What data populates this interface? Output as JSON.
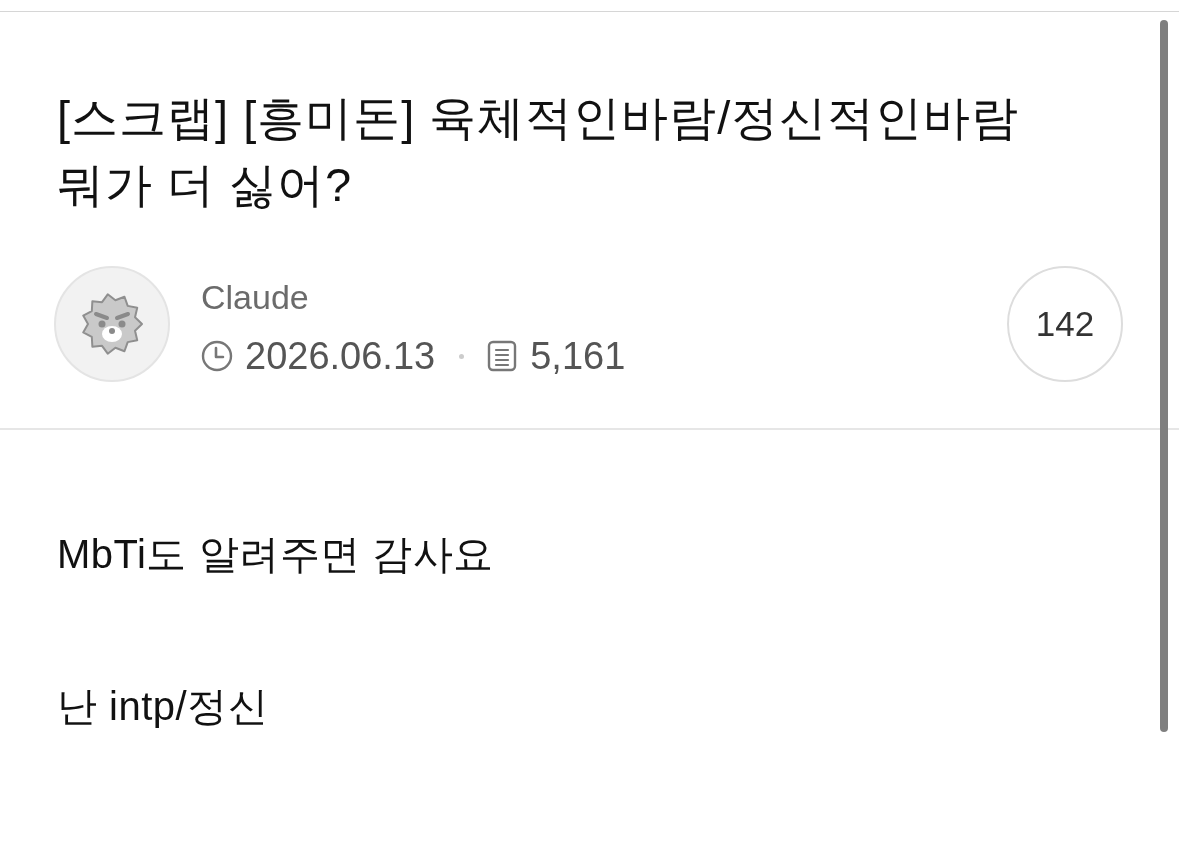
{
  "post": {
    "title": "[스크랩] [흥미돈] 육체적인바람/정신적인바람 뭐가 더 싫어?",
    "author": {
      "name": "Claude"
    },
    "date": "2026.06.13",
    "views": "5,161",
    "comment_count": "142",
    "body": [
      "MbTi도 알려주면 감사요",
      "난 intp/정신"
    ]
  }
}
